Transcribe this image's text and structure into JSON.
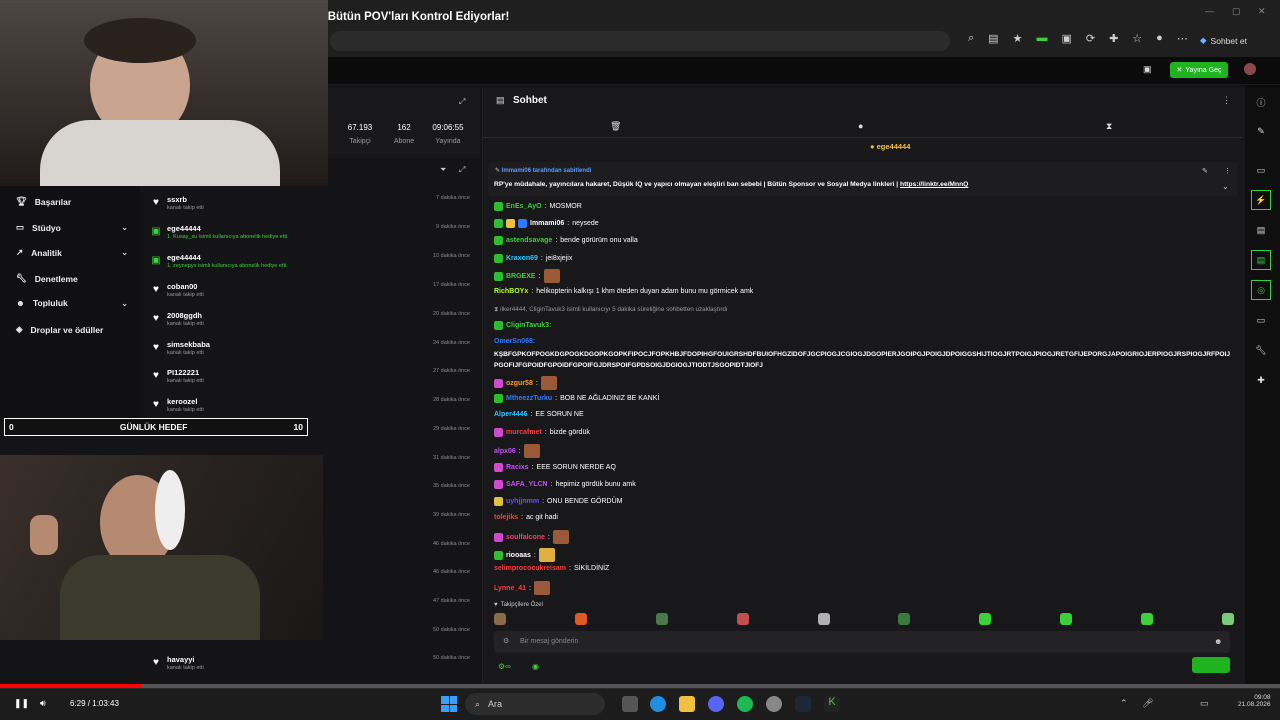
{
  "window": {
    "title": "Minik, Olaylı Çete Savaşı Sonrası Hile Kontrolüne Giriyor, Bütün POV'ları Kontrol Ediyorlar!",
    "chat_button": "Sohbet et"
  },
  "header": {
    "go_live": "Yayına Geç"
  },
  "stats": [
    {
      "value": "67.193",
      "label": "Takipçi"
    },
    {
      "value": "162",
      "label": "Abone"
    },
    {
      "value": "09:06:55",
      "label": "Yayında"
    }
  ],
  "sidebar": {
    "items": [
      {
        "label": "Başarılar",
        "icon": "trophy-icon",
        "chevron": false
      },
      {
        "label": "Stüdyo",
        "icon": "studio-icon",
        "chevron": true
      },
      {
        "label": "Analitik",
        "icon": "chart-icon",
        "chevron": true
      },
      {
        "label": "Denetleme",
        "icon": "wrench-icon",
        "chevron": false
      },
      {
        "label": "Topluluk",
        "icon": "people-icon",
        "chevron": true
      },
      {
        "label": "Droplar ve ödüller",
        "icon": "drop-icon",
        "chevron": false
      }
    ]
  },
  "activity": [
    {
      "name": "ssxrb",
      "sub": "kanalı takip etti",
      "time": "7 dakika önce",
      "type": "follow"
    },
    {
      "name": "ege44444",
      "sub": "1. Kusay_su isimli kullanıcıya abonelik hediye etti.",
      "time": "9 dakika önce",
      "type": "gift"
    },
    {
      "name": "ege44444",
      "sub": "1. zeynepys isimli kullanıcıya abonelik hediye etti.",
      "time": "10 dakika önce",
      "type": "gift"
    },
    {
      "name": "coban00",
      "sub": "kanalı takip etti",
      "time": "17 dakika önce",
      "type": "follow"
    },
    {
      "name": "2008ggdh",
      "sub": "kanalı takip etti",
      "time": "20 dakika önce",
      "type": "follow"
    },
    {
      "name": "simsekbaba",
      "sub": "kanalı takip etti",
      "time": "24 dakika önce",
      "type": "follow"
    },
    {
      "name": "PI122221",
      "sub": "kanalı takip etti",
      "time": "27 dakika önce",
      "type": "follow"
    },
    {
      "name": "keroozel",
      "sub": "kanalı takip etti",
      "time": "28 dakika önce",
      "type": "follow"
    },
    {
      "name": "",
      "sub": "",
      "time": "29 dakika önce",
      "type": "follow"
    },
    {
      "name": "",
      "sub": "",
      "time": "31 dakika önce",
      "type": "follow"
    },
    {
      "name": "",
      "sub": "",
      "time": "35 dakika önce",
      "type": "follow"
    },
    {
      "name": "",
      "sub": "",
      "time": "39 dakika önce",
      "type": "follow"
    },
    {
      "name": "",
      "sub": "",
      "time": "46 dakika önce",
      "type": "follow"
    },
    {
      "name": "",
      "sub": "",
      "time": "46 dakika önce",
      "type": "follow"
    },
    {
      "name": "",
      "sub": "",
      "time": "47 dakika önce",
      "type": "follow"
    },
    {
      "name": "",
      "sub": "",
      "time": "50 dakika önce",
      "type": "follow"
    },
    {
      "name": "havayyi",
      "sub": "kanalı takip etti",
      "time": "50 dakika önce",
      "type": "follow"
    }
  ],
  "goal": {
    "min": "0",
    "label": "GÜNLÜK HEDEF",
    "max": "10"
  },
  "chat": {
    "title": "Sohbet",
    "pinned_user": "ege44444",
    "pinned_by": "Immami06 tarafından sabitlendi",
    "pinned_text": "RP'ye müdahale, yayıncılara hakaret, Düşük IQ ve yapıcı olmayan eleştiri ban sebebi | Bütün Sponsor ve Sosyal Medya linkleri |",
    "pinned_link": "https://linktr.ee/MnnQ",
    "timeout_notice": "ilker4444, CliginTavuk3 isimli kullanıcıyı 5 dakika süreliğine sohbetten uzaklaştırdı",
    "long_user": "CliginTavuk3:",
    "long_user2": "OmerSn068:",
    "long_text": "KŞBFGPKOFPOGKDGPOGKDGOPKGOPKFIPOCJFOPKHBJFDOPIHGFOUIGRSHDFBUIOFHGZIDOFJGCPIOGJCGIOGJDGOPIERJGOIPGJPOIGJDPOIGGSHIJTIOGJRTPOIGJPIOGJRETGFIJEPORGJAPOIGRIOJERPIOGJRSPIOGJRFPOIJPGOFIJFGPOIDFGPOIDFGPOIFGJDRSPOIFGPDSOIGJDGIOGJTIODTJSGOPIDTJIOFJ",
    "messages": [
      {
        "user": "EnEs_AyO",
        "text": "MOSMOR",
        "color": "#3ad13a"
      },
      {
        "user": "Immami06",
        "text": "neysede",
        "color": "#ffffff"
      },
      {
        "user": "astendsavage",
        "text": "bende görürüm onu valla",
        "color": "#3ad13a"
      },
      {
        "user": "Kraxon69",
        "text": "jei8xjejix",
        "color": "#2fc6ff"
      },
      {
        "user": "BRGEXE",
        "text": "",
        "color": "#3ad13a"
      },
      {
        "user": "RichBOYx",
        "text": "helikopterin kalkışı 1 khm öteden duyan adam bunu mu görmicek amk",
        "color": "#b8ff2e"
      },
      {
        "user": "ozgur58",
        "text": "",
        "color": "#ff9b2e"
      },
      {
        "user": "MtheezzTurku",
        "text": "BOB NE AĞLADINIZ BE KANKİ",
        "color": "#2f7bff"
      },
      {
        "user": "Alper4446",
        "text": "EE SORUN NE",
        "color": "#2fc6ff"
      },
      {
        "user": "murcafmet",
        "text": "bizde gördük",
        "color": "#ff3b3b"
      },
      {
        "user": "alpx06",
        "text": "",
        "color": "#c74dff"
      },
      {
        "user": "Racixs",
        "text": "EEE SORUN NERDE AQ",
        "color": "#c74dff"
      },
      {
        "user": "SAFA_YLCN",
        "text": "hepimiz gördük bunu amk",
        "color": "#c74dff"
      },
      {
        "user": "uyhjjnmm",
        "text": "ONU BENDE GÖRDÜM",
        "color": "#6f4dff"
      },
      {
        "user": "tolejiks",
        "text": "ac git hadi",
        "color": "#ff3b3b"
      },
      {
        "user": "soulfalcone",
        "text": "",
        "color": "#ff3b6b"
      },
      {
        "user": "riooaas",
        "text": "",
        "color": "#ffffff"
      },
      {
        "user": "selimprococukreisam",
        "text": "SİKİLDİNİZ",
        "color": "#ff3b3b"
      },
      {
        "user": "Lynne_41",
        "text": "",
        "color": "#ff3b3b"
      }
    ],
    "followers_only": "Takipçilere Özel",
    "input_placeholder": "Bir mesaj gönderin"
  },
  "player": {
    "time": "6:29 / 1:03:43",
    "progress": 0.11
  },
  "taskbar": {
    "search": "Ara",
    "clock_time": "09:08",
    "clock_date": "21.08.2026"
  }
}
